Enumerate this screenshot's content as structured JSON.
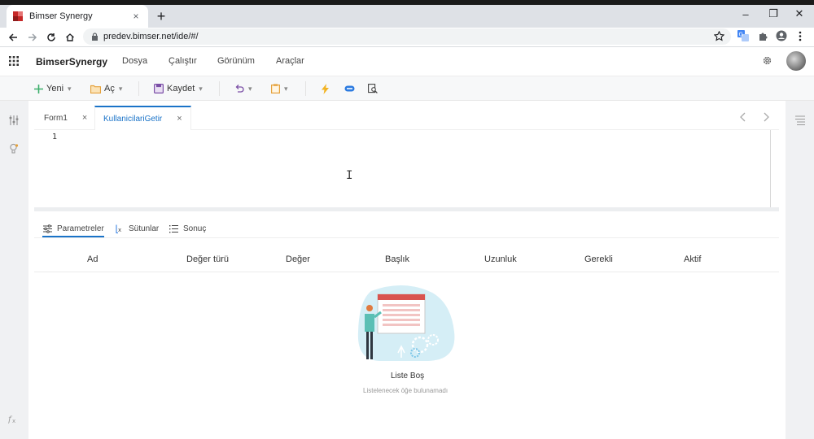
{
  "browser": {
    "tab_title": "Bimser Synergy",
    "tab_close": "×",
    "new_tab": "+",
    "url": "predev.bimser.net/ide/#/",
    "min": "–",
    "restore": "❐",
    "close": "✕"
  },
  "app": {
    "brand": "BimserSynergy",
    "menu": [
      "Dosya",
      "Çalıştır",
      "Görünüm",
      "Araçlar"
    ]
  },
  "toolbar": {
    "new_label": "Yeni",
    "open_label": "Aç",
    "save_label": "Kaydet"
  },
  "editor": {
    "tabs": [
      {
        "label": "Form1",
        "close": "×"
      },
      {
        "label": "KullanicilariGetir",
        "close": "×"
      }
    ],
    "line_number": "1",
    "cursor": "I"
  },
  "panel": {
    "tabs": [
      "Parametreler",
      "Sütunlar",
      "Sonuç"
    ],
    "columns": [
      "Ad",
      "Değer türü",
      "Değer",
      "Başlık",
      "Uzunluk",
      "Gerekli",
      "Aktif"
    ],
    "empty_title": "Liste Boş",
    "empty_subtitle": "Listelenecek öğe bulunamadı"
  },
  "colors": {
    "accent": "#1a73c8",
    "new_icon": "#3cae6b",
    "folder_icon": "#e5a13b",
    "save_icon": "#7b4fa6",
    "run_icon": "#f2b322",
    "debug_icon": "#2d7be0",
    "favicon_red": "#c62828"
  },
  "icons": {
    "favicon": "bimser-logo-icon",
    "back": "arrow-left-icon",
    "forward": "arrow-right-icon",
    "reload": "reload-icon",
    "home": "home-icon",
    "lock": "lock-icon",
    "star": "star-icon",
    "translate": "translate-icon",
    "extensions": "puzzle-icon",
    "profile": "profile-icon",
    "more": "kebab-icon",
    "apps": "grid-icon",
    "settings": "gear-icon"
  }
}
